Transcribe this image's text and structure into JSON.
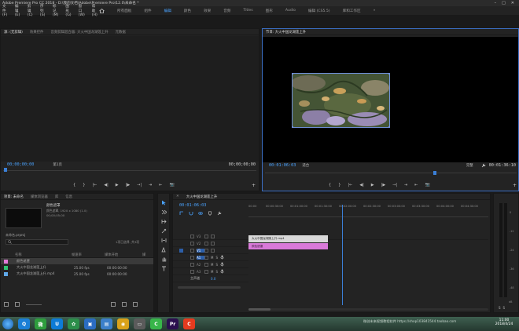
{
  "window": {
    "title": "Adobe Premiere Pro CC 2018 - D:\\我的文档\\Adobe\\Premiere Pro\\12.0\\未命名 *",
    "controls": [
      "–",
      "□",
      "✕"
    ]
  },
  "menu": [
    "文件(F)",
    "编辑(E)",
    "剪辑(C)",
    "序列(S)",
    "标记(M)",
    "图形(G)",
    "窗口(W)",
    "帮助(H)"
  ],
  "workspaces": {
    "items": [
      "所有面板",
      "组件",
      "编辑",
      "颜色",
      "效果",
      "音频",
      "Titles",
      "图形",
      "Audio",
      "编辑 (CS5.5)",
      "库和工作区"
    ],
    "active_index": 2,
    "more": "»"
  },
  "source_panel": {
    "tabs": [
      "源: (无剪辑)",
      "效果控件",
      "音频剪辑混合器: 大火中国龙湖莲上升",
      "元数据"
    ],
    "active_index": 0,
    "timecode_left": "00;00;00;00",
    "page_label": "第1页",
    "timecode_right": "00;00;00;00"
  },
  "program_panel": {
    "title": "节目: 大火中国龙湖莲上升",
    "timecode_left": "00:01:06:03",
    "fit_label": "适合",
    "quality_label": "完整",
    "timecode_right": "00:01:36:10"
  },
  "transport": [
    "{",
    "}",
    "|←",
    "◀|",
    "▶",
    "|▶",
    "→|",
    "⇥",
    "⇤",
    "📷",
    "+"
  ],
  "project_panel": {
    "tabs": [
      "项目: 未命名",
      "媒体浏览器",
      "库",
      "信息"
    ],
    "item": {
      "name": "颜色遮罩",
      "info_line1": "颜色遮罩, 1920 x 1080 (1.0)",
      "info_line2": "00;00;05;00"
    },
    "file_name": "未命名.prproj",
    "search_placeholder": "",
    "count_label": "1项已选择, 共3项",
    "columns": [
      "名称",
      "帧速率",
      "媒体开始",
      "媒"
    ],
    "rows": [
      {
        "name": "颜色遮罩",
        "rate": "",
        "start": "",
        "color": "#e27ad8"
      },
      {
        "name": "大火中国龙湖莲上升",
        "rate": "25.00 fps",
        "start": "00:00:00:00",
        "color": "#2fc473"
      },
      {
        "name": "大火中国龙湖莲上升.mp4",
        "rate": "25.00 fps",
        "start": "00:00:00:00",
        "color": "#5fa8e8"
      }
    ]
  },
  "timeline": {
    "tab": "大火中国龙湖莲上升",
    "timecode": "00:01:06:03",
    "ruler": [
      "00:00",
      "00:00:30:00",
      "00:01:00:00",
      "00:01:30:00",
      "00:02:00:00",
      "00:02:30:00",
      "00:03:00:00",
      "00:03:30:00",
      "00:04:00:00",
      "00:04:30:00"
    ],
    "tracks": {
      "video": [
        "V3",
        "V2",
        "V1"
      ],
      "audio": [
        "A1",
        "A2",
        "A3"
      ],
      "master": "主声道",
      "master_value": "0.0"
    },
    "toggles": [
      "M",
      "S"
    ],
    "clip_video": "大火中国龙湖莲上升.mp4",
    "clip_color": "颜色遮罩",
    "playhead_fraction": 0.39
  },
  "meters": {
    "scale": [
      "0",
      "-12",
      "-24",
      "-36",
      "-48",
      "dB"
    ],
    "solo": [
      "S",
      "S"
    ]
  },
  "taskbar": {
    "apps": [
      {
        "label": "Q",
        "color": "#1b7fd6"
      },
      {
        "label": "微",
        "color": "#2e9d3d"
      },
      {
        "label": "U",
        "color": "#0d7bd6"
      },
      {
        "label": "✿",
        "color": "#2c8e4a"
      },
      {
        "label": "▣",
        "color": "#2b6dc2"
      },
      {
        "label": "▤",
        "color": "#3b7fc9"
      },
      {
        "label": "◉",
        "color": "#d9a21a"
      },
      {
        "label": "▭",
        "color": "#5b5b5b"
      },
      {
        "label": "C",
        "color": "#38b64a"
      },
      {
        "label": "Pr",
        "color": "#2b0f4f"
      },
      {
        "label": "C",
        "color": "#e53b1f"
      }
    ],
    "watermark": "微创未来视频教程软件 https://shop103841544.taobao.com",
    "time": "11:00",
    "date": "2018/4/24"
  }
}
